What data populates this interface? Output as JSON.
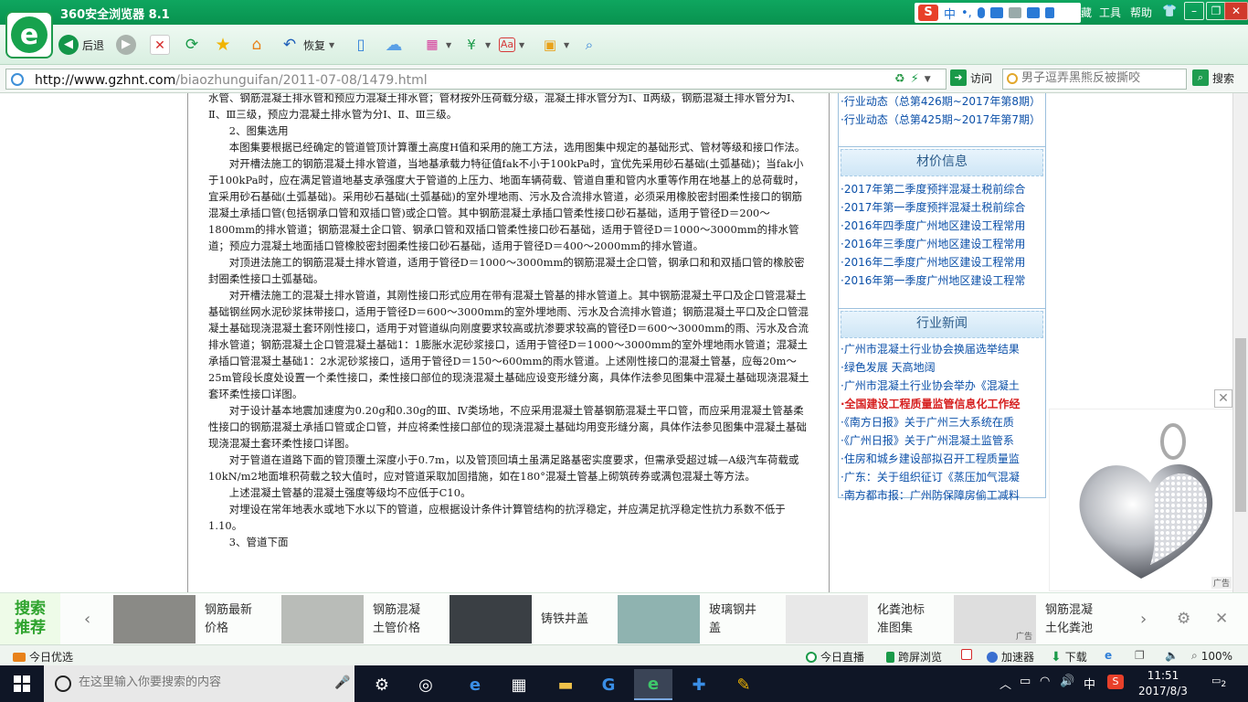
{
  "window": {
    "title": "360安全浏览器 8.1",
    "menu": [
      "工具",
      "帮助"
    ],
    "menu_partial": "藏",
    "ime": {
      "logo": "S",
      "lang": "中",
      "punct": "•,"
    }
  },
  "toolbar": {
    "back_label": "后退",
    "restore_label": "恢复"
  },
  "address": {
    "url_host": "http://www.gzhnt.com",
    "url_path": "/biaozhunguifan/2011-07-08/1479.html",
    "go_label": "访问",
    "search_placeholder": "男子逗弄黑熊反被撕咬",
    "search_label": "搜索"
  },
  "article": {
    "paragraphs": [
      {
        "indent": false,
        "text": "水管、钢筋混凝土排水管和预应力混凝土排水管；管材按外压荷载分级，混凝土排水管分为Ⅰ、Ⅱ两级，钢筋混凝土排水管分为Ⅰ、Ⅱ、Ⅲ三级，预应力混凝土排水管为分Ⅰ、Ⅱ、Ⅲ三级。"
      },
      {
        "indent": true,
        "text": "2、图集选用"
      },
      {
        "indent": true,
        "text": "本图集要根据已经确定的管道管顶计算覆土高度H值和采用的施工方法，选用图集中规定的基础形式、管材等级和接口作法。"
      },
      {
        "indent": true,
        "text": "对开槽法施工的钢筋混凝土排水管道，当地基承载力特征值fak不小于100kPa时，宜优先采用砂石基础(土弧基础)；当fak小于100kPa时，应在满足管道地基支承强度大于管道的上压力、地面车辆荷载、管道自重和管内水重等作用在地基上的总荷载时，宜采用砂石基础(土弧基础)。采用砂石基础(土弧基础)的室外埋地雨、污水及合流排水管道，必须采用橡胶密封圈柔性接口的钢筋混凝土承插口管(包括钢承口管和双插口管)或企口管。其中钢筋混凝土承插口管柔性接口砂石基础，适用于管径D＝200～1800mm的排水管道；钢筋混凝土企口管、钢承口管和双插口管柔性接口砂石基础，适用于管径D＝1000～3000mm的排水管道；预应力混凝土地面插口管橡胶密封圈柔性接口砂石基础，适用于管径D＝400～2000mm的排水管道。"
      },
      {
        "indent": true,
        "text": "对顶进法施工的钢筋混凝土排水管道，适用于管径D＝1000～3000mm的钢筋混凝土企口管，钢承口和和双插口管的橡胶密封圈柔性接口土弧基础。"
      },
      {
        "indent": true,
        "text": "对开槽法施工的混凝土排水管道，其刚性接口形式应用在带有混凝土管基的排水管道上。其中钢筋混凝土平口及企口管混凝土基础钢丝网水泥砂浆抹带接口，适用于管径D＝600～3000mm的室外埋地雨、污水及合流排水管道；钢筋混凝土平口及企口管混凝土基础现浇混凝土套环刚性接口，适用于对管道纵向刚度要求较高或抗渗要求较高的管径D＝600～3000mm的雨、污水及合流排水管道；钢筋混凝土企口管混凝土基础1：1膨胀水泥砂浆接口，适用于管径D＝1000～3000mm的室外埋地雨水管道；混凝土承插口管混凝土基础1：2水泥砂浆接口，适用于管径D＝150～600mm的雨水管道。上述刚性接口的混凝土管基，应每20m～25m管段长度处设置一个柔性接口，柔性接口部位的现浇混凝土基础应设变形缝分离，具体作法参见图集中混凝土基础现浇混凝土套环柔性接口详图。"
      },
      {
        "indent": true,
        "text": "对于设计基本地震加速度为0.20g和0.30g的Ⅲ、Ⅳ类场地，不应采用混凝土管基钢筋混凝土平口管，而应采用混凝土管基柔性接口的钢筋混凝土承插口管或企口管，并应将柔性接口部位的现浇混凝土基础均用变形缝分离，具体作法参见图集中混凝土基础现浇混凝土套环柔性接口详图。"
      },
      {
        "indent": true,
        "text": "对于管道在道路下面的管顶覆土深度小于0.7m，以及管顶回填土虽满足路基密实度要求，但需承受超过城—A级汽车荷载或10kN/m2地面堆积荷载之较大值时，应对管道采取加固措施，如在180°混凝土管基上砌筑砖券或满包混凝土等方法。"
      },
      {
        "indent": true,
        "text": "上述混凝土管基的混凝土强度等级均不应低于C10。"
      },
      {
        "indent": true,
        "text": "对埋设在常年地表水或地下水以下的管道，应根据设计条件计算管结构的抗浮稳定，并应满足抗浮稳定性抗力系数不低于1.10。"
      },
      {
        "indent": true,
        "text": "3、管道下面"
      }
    ]
  },
  "sidebar": {
    "top_items": [
      "·行业动态（总第426期~2017年第8期）",
      "·行业动态（总第425期~2017年第7期）"
    ],
    "price_title": "材价信息",
    "price_items": [
      "·2017年第二季度预拌混凝土税前综合",
      "·2017年第一季度预拌混凝土税前综合",
      "·2016年四季度广州地区建设工程常用",
      "·2016年三季度广州地区建设工程常用",
      "·2016年二季度广州地区建设工程常用",
      "·2016年第一季度广州地区建设工程常"
    ],
    "news_title": "行业新闻",
    "news_items": [
      {
        "text": "·广州市混凝土行业协会换届选举结果",
        "highlight": false
      },
      {
        "text": "·绿色发展 天高地阔",
        "highlight": false
      },
      {
        "text": "·广州市混凝土行业协会举办《混凝土",
        "highlight": false
      },
      {
        "text": "·全国建设工程质量监管信息化工作经",
        "highlight": true
      },
      {
        "text": "·《南方日报》关于广州三大系统在质",
        "highlight": false
      },
      {
        "text": "·《广州日报》关于广州混凝土监管系",
        "highlight": false
      },
      {
        "text": "·住房和城乡建设部拟召开工程质量监",
        "highlight": false
      },
      {
        "text": "·广东：关于组织征订《蒸压加气混凝",
        "highlight": false
      },
      {
        "text": "·南方都市报：广州防保障房偷工减料",
        "highlight": false
      }
    ]
  },
  "ad": {
    "tag": "广告",
    "close": "✕"
  },
  "recommend": {
    "title_line1": "搜索",
    "title_line2": "推荐",
    "items": [
      {
        "label": "钢筋最新价格",
        "img": "#8a8a86"
      },
      {
        "label": "钢筋混凝土管价格",
        "img": "#b9bcb8"
      },
      {
        "label": "铸铁井盖",
        "img": "#3a3f44"
      },
      {
        "label": "玻璃钢井盖",
        "img": "#8fb3b0"
      },
      {
        "label": "化粪池标准图集",
        "img": "#e8e8e8"
      },
      {
        "label": "钢筋混凝土化粪池",
        "img": "#dedede"
      }
    ],
    "item_ad_tag": "广告"
  },
  "statusbar": {
    "left": "今日优选",
    "items": [
      "今日直播",
      "跨屏浏览",
      "加速器",
      "下载"
    ],
    "zoom": "100%"
  },
  "taskbar": {
    "search_placeholder": "在这里输入你要搜索的内容",
    "ime": "中",
    "time": "11:51",
    "date": "2017/8/3",
    "notifications": "2"
  },
  "colors": {
    "browser_green": "#0fa65f",
    "link_blue": "#0a4fa8",
    "highlight_red": "#d61f1f",
    "taskbar": "#0f1626"
  }
}
